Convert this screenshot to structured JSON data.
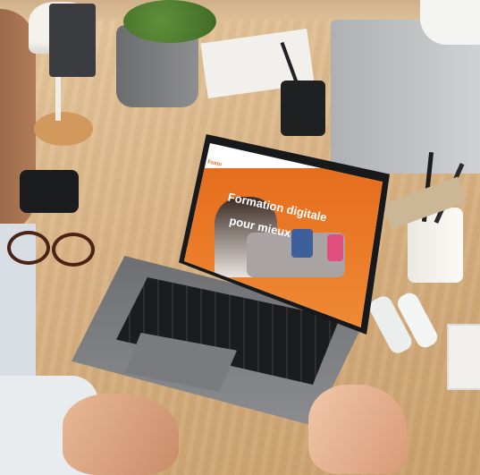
{
  "photo": {
    "subject": "Person using a laptop at a wooden desk",
    "screen": {
      "brand": "Fasto",
      "headline_line1": "Formation digitale",
      "headline_line2": "pour mieux",
      "colors": {
        "accent": "#e8701f",
        "screen_bg": "#ffffff",
        "laptop": "#2a2b2e"
      }
    }
  }
}
